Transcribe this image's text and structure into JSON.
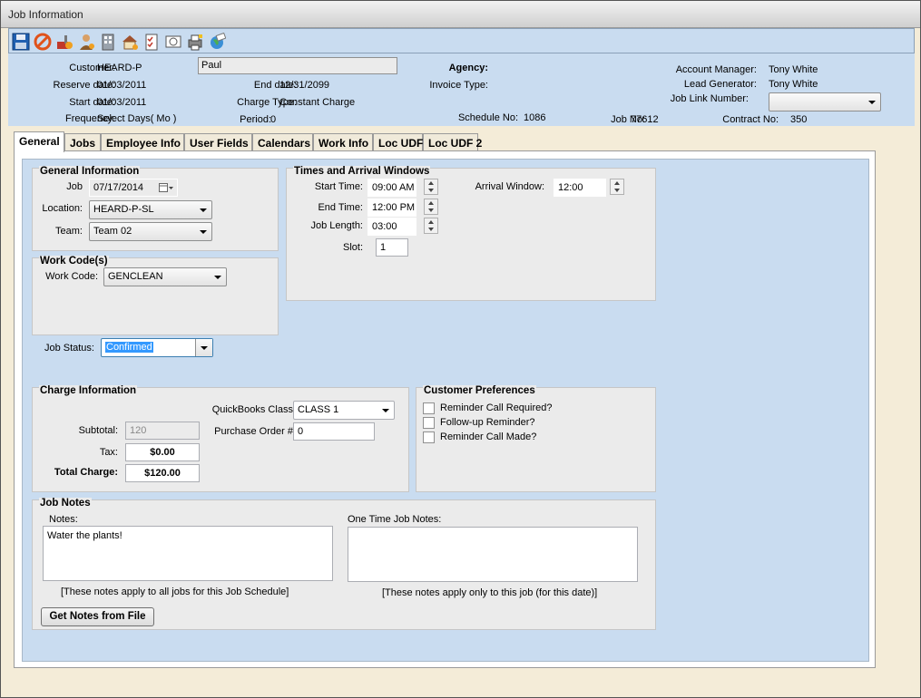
{
  "window": {
    "title": "Job Information"
  },
  "toolbar": {
    "icons": [
      "save-icon",
      "cancel-icon",
      "tools-icon",
      "person-icon",
      "building-icon",
      "house-icon",
      "checklist-icon",
      "preview-icon",
      "print-icon",
      "globe-icon"
    ]
  },
  "header": {
    "customer_label": "Customer:",
    "customer": "HEARD-P",
    "contact_name": "Paul",
    "reserve_date_label": "Reserve date:",
    "reserve_date": "01/03/2011",
    "start_date_label": "Start date:",
    "start_date": "01/03/2011",
    "frequency_label": "Frequency:",
    "frequency": "Select Days( Mo )",
    "end_date_label": "End date:",
    "end_date": "12/31/2099",
    "charge_type_label": "Charge Type:",
    "charge_type": "Constant Charge",
    "period_label": "Period:",
    "period": "0",
    "agency_label": "Agency:",
    "invoice_type_label": "Invoice Type:",
    "schedule_no_label": "Schedule No:",
    "schedule_no": "1086",
    "job_no_label": "Job No:",
    "job_no": "77612",
    "account_manager_label": "Account Manager:",
    "account_manager": "Tony White",
    "lead_generator_label": "Lead Generator:",
    "lead_generator": "Tony White",
    "job_link_label": "Job Link Number:",
    "job_link": "",
    "contract_no_label": "Contract No:",
    "contract_no": "350"
  },
  "tabs": [
    "General",
    "Jobs",
    "Employee Info",
    "User Fields",
    "Calendars",
    "Work Info",
    "Loc UDF",
    "Loc UDF 2"
  ],
  "general_info": {
    "title": "General Information",
    "job_label": "Job",
    "job_date": "07/17/2014",
    "location_label": "Location:",
    "location": "HEARD-P-SL",
    "team_label": "Team:",
    "team": "Team 02"
  },
  "work_codes": {
    "title": "Work Code(s)",
    "work_code_label": "Work Code:",
    "work_code": "GENCLEAN"
  },
  "job_status": {
    "label": "Job Status:",
    "value": "Confirmed"
  },
  "times": {
    "title": "Times and Arrival Windows",
    "start_label": "Start Time:",
    "start": "09:00 AM",
    "end_label": "End Time:",
    "end": "12:00 PM",
    "length_label": "Job Length:",
    "length": "03:00",
    "slot_label": "Slot:",
    "slot": "1",
    "arrival_label": "Arrival Window:",
    "arrival": "12:00"
  },
  "charge": {
    "title": "Charge Information",
    "qb_class_label": "QuickBooks Class:",
    "qb_class": "CLASS 1",
    "subtotal_label": "Subtotal:",
    "subtotal": "120",
    "po_label": "Purchase Order #:",
    "po": "0",
    "tax_label": "Tax:",
    "tax": "$0.00",
    "total_label": "Total Charge:",
    "total": "$120.00"
  },
  "prefs": {
    "title": "Customer Preferences",
    "items": [
      "Reminder Call Required?",
      "Follow-up Reminder?",
      "Reminder Call Made?"
    ]
  },
  "notes": {
    "title": "Job Notes",
    "notes_label": "Notes:",
    "notes": "Water the plants!",
    "notes_hint": "[These notes apply to all jobs for this Job Schedule]",
    "one_time_label": "One Time Job Notes:",
    "one_time": "",
    "one_time_hint": "[These notes apply only to this job (for this date)]",
    "get_notes_button": "Get Notes from File"
  }
}
